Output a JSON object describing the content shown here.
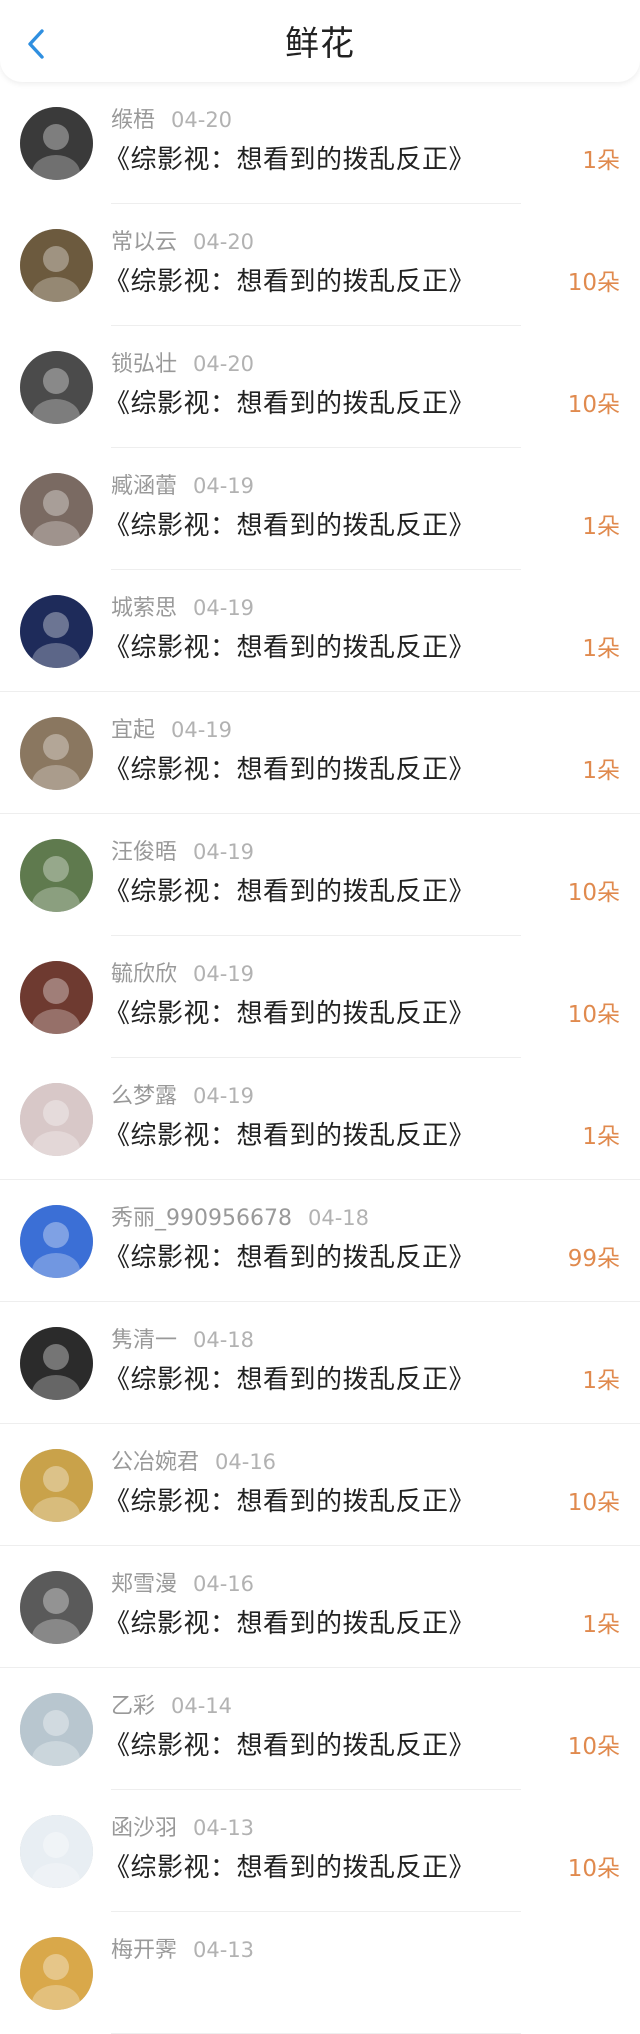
{
  "header": {
    "title": "鲜花"
  },
  "colors": {
    "accent": "#2f8fe0",
    "count": "#e08a4e"
  },
  "rows": [
    {
      "name": "缑梧",
      "date": "04-20",
      "book": "《综影视：想看到的拨乱反正》",
      "count": "1朵"
    },
    {
      "name": "常以云",
      "date": "04-20",
      "book": "《综影视：想看到的拨乱反正》",
      "count": "10朵"
    },
    {
      "name": "锁弘壮",
      "date": "04-20",
      "book": "《综影视：想看到的拨乱反正》",
      "count": "10朵"
    },
    {
      "name": "臧涵蕾",
      "date": "04-19",
      "book": "《综影视：想看到的拨乱反正》",
      "count": "1朵"
    },
    {
      "name": "城萦思",
      "date": "04-19",
      "book": "《综影视：想看到的拨乱反正》",
      "count": "1朵"
    },
    {
      "name": "宜起",
      "date": "04-19",
      "book": "《综影视：想看到的拨乱反正》",
      "count": "1朵"
    },
    {
      "name": "汪俊晤",
      "date": "04-19",
      "book": "《综影视：想看到的拨乱反正》",
      "count": "10朵"
    },
    {
      "name": "毓欣欣",
      "date": "04-19",
      "book": "《综影视：想看到的拨乱反正》",
      "count": "10朵"
    },
    {
      "name": "么梦露",
      "date": "04-19",
      "book": "《综影视：想看到的拨乱反正》",
      "count": "1朵"
    },
    {
      "name": "秀丽_990956678",
      "date": "04-18",
      "book": "《综影视：想看到的拨乱反正》",
      "count": "99朵"
    },
    {
      "name": "隽清一",
      "date": "04-18",
      "book": "《综影视：想看到的拨乱反正》",
      "count": "1朵"
    },
    {
      "name": "公冶婉君",
      "date": "04-16",
      "book": "《综影视：想看到的拨乱反正》",
      "count": "10朵"
    },
    {
      "name": "郏雪漫",
      "date": "04-16",
      "book": "《综影视：想看到的拨乱反正》",
      "count": "1朵"
    },
    {
      "name": "乙彩",
      "date": "04-14",
      "book": "《综影视：想看到的拨乱反正》",
      "count": "10朵"
    },
    {
      "name": "函沙羽",
      "date": "04-13",
      "book": "《综影视：想看到的拨乱反正》",
      "count": "10朵"
    },
    {
      "name": "梅开霁",
      "date": "04-13",
      "book": "",
      "count": ""
    }
  ]
}
